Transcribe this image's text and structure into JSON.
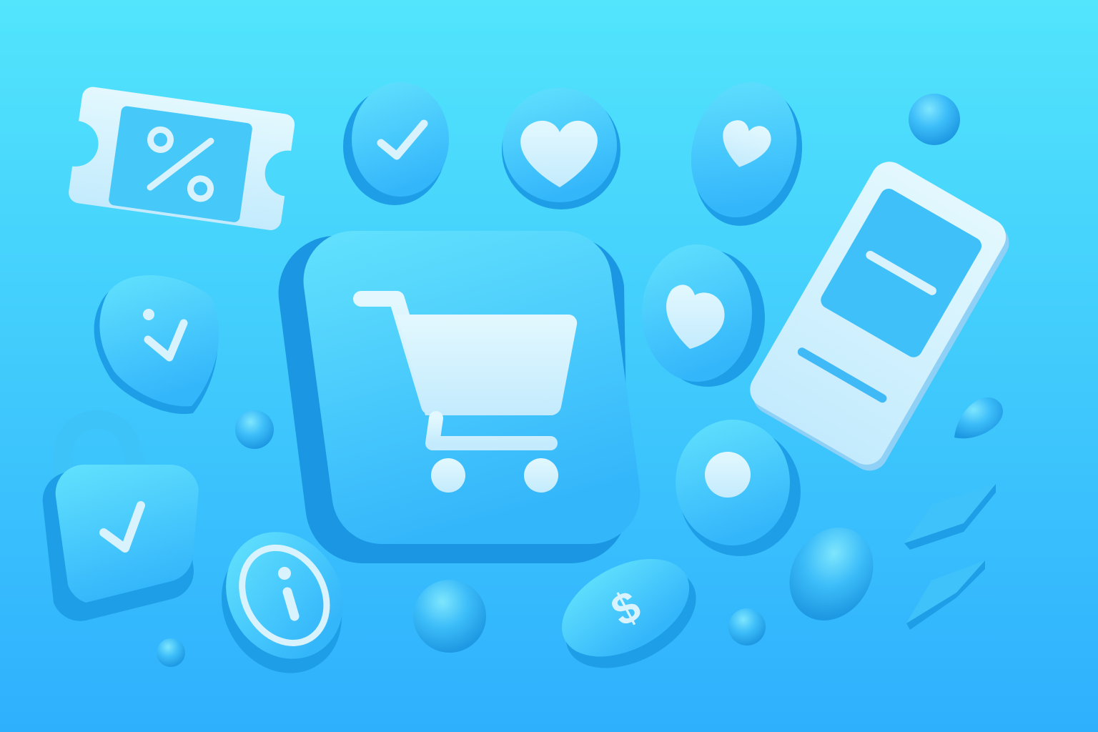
{
  "colors": {
    "background_top": "#52e5fc",
    "background_bottom": "#2fb0fd",
    "icon_face": "#3cc6fb",
    "icon_side": "#1b98e4",
    "glyph": "#d8f3fd"
  },
  "icons": [
    "discount-coupon-icon",
    "checkmark-badge-icon",
    "heart-badge-icon",
    "heart-pebble-icon",
    "smartphone-icon",
    "shield-check-icon",
    "padlock-check-icon",
    "shopping-cart-icon",
    "heart-oval-icon",
    "dot-button-icon",
    "info-coin-icon",
    "dollar-coin-icon"
  ]
}
